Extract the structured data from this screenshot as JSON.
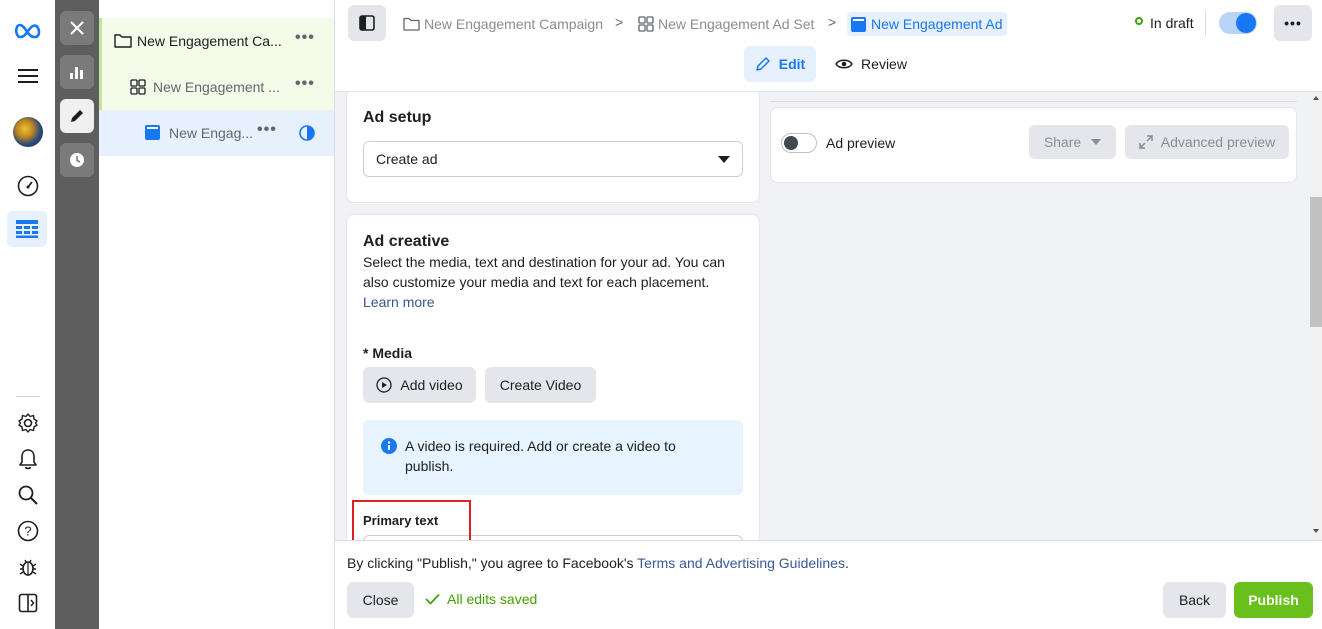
{
  "breadcrumbs": [
    {
      "label": "New Engagement Campaign"
    },
    {
      "label": "New Engagement Ad Set"
    },
    {
      "label": "New Engagement Ad"
    }
  ],
  "status": {
    "label": "In draft"
  },
  "mode_tabs": {
    "edit": "Edit",
    "review": "Review"
  },
  "tree": {
    "campaign": "New Engagement Ca...",
    "adset": "New Engagement ...",
    "ad": "New Engag..."
  },
  "ad_setup": {
    "title": "Ad setup",
    "select_value": "Create ad"
  },
  "ad_creative": {
    "title": "Ad creative",
    "description": "Select the media, text and destination for your ad. You can also customize your media and text for each placement.",
    "learn_more": "Learn more",
    "media_label": "* Media",
    "add_video": "Add video",
    "create_video": "Create Video",
    "notice": "A video is required. Add or create a video to publish.",
    "primary_text_label": "Primary text"
  },
  "preview": {
    "toggle_label": "Ad preview",
    "share": "Share",
    "advanced": "Advanced preview"
  },
  "footer": {
    "terms_prefix": "By clicking \"Publish,\" you agree to Facebook's ",
    "terms_link": "Terms and Advertising Guidelines",
    "terms_suffix": ".",
    "close": "Close",
    "saved": "All edits saved",
    "back": "Back",
    "publish": "Publish"
  },
  "colors": {
    "brand_blue": "#1877f2",
    "publish_green": "#69c01c",
    "saved_green": "#42a000",
    "highlight_red": "#e02020"
  }
}
